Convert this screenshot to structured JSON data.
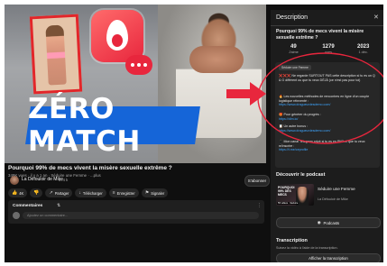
{
  "colors": {
    "background": "#0f0f0f",
    "panel": "#1c1c1c",
    "accent_red": "#e8263d",
    "thumbnail_banner": "#1565d8",
    "link": "#3ea6ff"
  },
  "video": {
    "thumbnail_text": "ZÉRO MATCH",
    "title": "Pourquoi 99% de mecs vivent la misère sexuelle extrême ?",
    "stats_line": "349K vues · il y a 1 an · Séduire une Femme · ...plus",
    "channel_name": "La Défouloir de Mike",
    "channel_subs": "574 k",
    "subscribe_label": "S'abonner"
  },
  "actions": [
    {
      "icon": "like-icon",
      "glyph": "👍",
      "label": "4K"
    },
    {
      "icon": "dislike-icon",
      "glyph": "👎",
      "label": ""
    },
    {
      "icon": "share-icon",
      "glyph": "↗",
      "label": "Partager"
    },
    {
      "icon": "download-icon",
      "glyph": "↓",
      "label": "Télécharger"
    },
    {
      "icon": "save-icon",
      "glyph": "≡",
      "label": "Enregistrer"
    },
    {
      "icon": "flag-icon",
      "glyph": "⚑",
      "label": "Signaler"
    }
  ],
  "comments": {
    "title": "Commentaires",
    "sort_icon": "sort-icon",
    "placeholder": "Ajoutez un commentaire..."
  },
  "description": {
    "header": "Description",
    "close_icon": "close-icon",
    "title": "Pourquoi 99% de mecs vivent la misère sexuelle extrême ?",
    "stats": [
      {
        "value": "49",
        "label": "J'aime"
      },
      {
        "value": "1279",
        "label": "vues"
      },
      {
        "value": "2023",
        "label": "1 déc."
      }
    ],
    "chip": "Séduire une Femme",
    "blocks": [
      {
        "prefix": "❌❌❌",
        "text": " Ne regarde SURTOUT PAS cette description si tu es un Q & G différent ou que tu veux DÉJÀ (ce n'est pas pour toi)",
        "link": ""
      },
      {
        "prefix": "🔥",
        "text": " Les nouvelles méthodes de rencontres en ligne d'un couple logistique réinventé :",
        "link": "https://www.dragueurdesdemo.com/"
      },
      {
        "prefix": "🎁",
        "text": " Pour générer du progrès :",
        "link": "https://dlm.io/"
      },
      {
        "prefix": "📋",
        "text": " Un autre bonus :",
        "link": "https://www.dragueurdesdemo.com/"
      },
      {
        "prefix": "📱",
        "text": " Mon canal Telegram privé si tu es en PN3 et que tu veux m'inscrire :",
        "link": "https://t.me/ceprofile"
      }
    ]
  },
  "podcast": {
    "section_title": "Découvrir le podcast",
    "thumb_text": "POURQUOI 99% DES MECS",
    "thumb_duration": "55 vidéos · Séduire",
    "name": "Séduire une Femme",
    "channel": "La Défouloir de Mike",
    "button_label": "Podcasts"
  },
  "transcript": {
    "title": "Transcription",
    "text": "Suivez la vidéo à l'aide de la transcription.",
    "button_label": "Afficher la transcription"
  }
}
